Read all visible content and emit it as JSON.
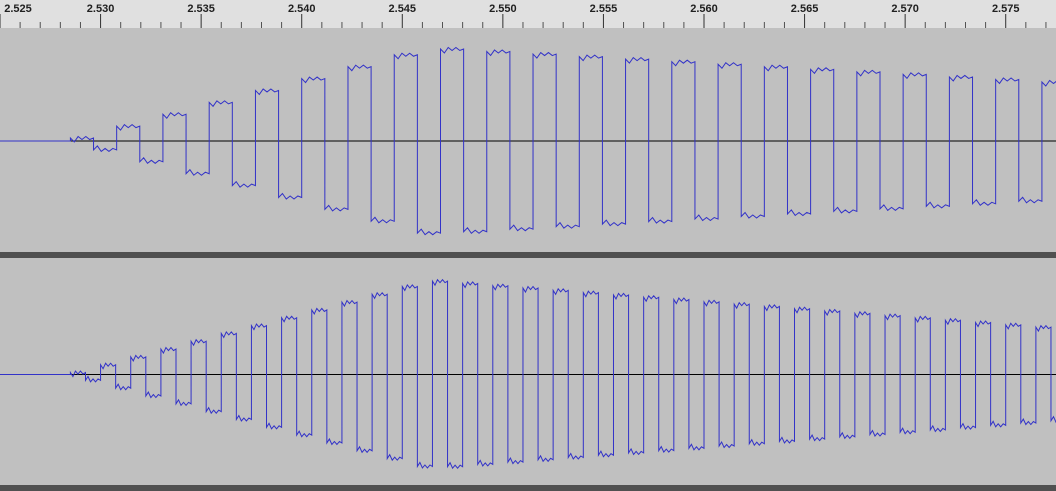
{
  "ruler": {
    "ticks": [
      "2.525",
      "2.530",
      "2.535",
      "2.540",
      "2.545",
      "2.550",
      "2.555",
      "2.560",
      "2.565",
      "2.570",
      "2.575"
    ],
    "start": 2.525,
    "end": 2.5775
  },
  "tracks": [
    {
      "channel": "left",
      "onset_time": 2.5285,
      "period_s": 0.0023,
      "peak_time": 2.5465,
      "peak_amp": 0.87,
      "end_amp": 0.55
    },
    {
      "channel": "right",
      "onset_time": 2.5285,
      "period_s": 0.0015,
      "peak_time": 2.5465,
      "peak_amp": 0.85,
      "end_amp": 0.42
    }
  ],
  "colors": {
    "background": "#c0c0c0",
    "waveform": "#3232c8",
    "center_line": "#000000",
    "ruler": "#e0e0e0"
  }
}
